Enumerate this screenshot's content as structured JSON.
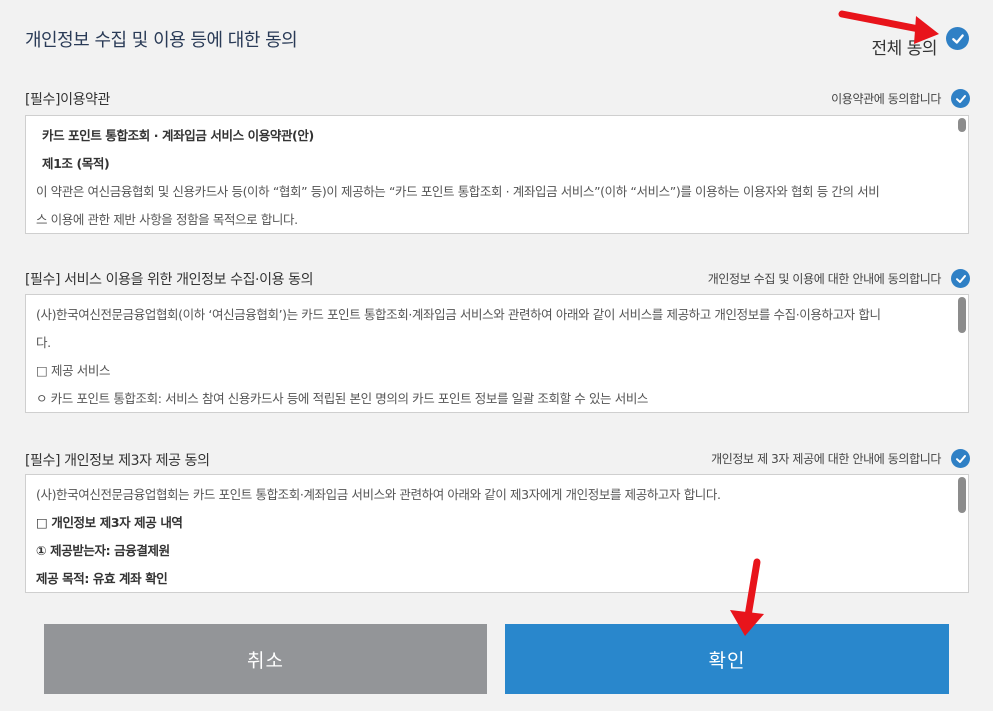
{
  "header": {
    "title": "개인정보 수집 및 이용 등에 대한 동의",
    "all_agree_label": "전체 동의"
  },
  "sections": [
    {
      "title": "[필수]이용약관",
      "agree_label": "이용약관에 동의합니다",
      "lines": [
        "카드 포인트 통합조회 · 계좌입금 서비스 이용약관(안)",
        "제1조 (목적)",
        "이 약관은 여신금융협회 및 신용카드사 등(이하 “협회” 등)이 제공하는 “카드 포인트 통합조회 · 계좌입금 서비스”(이하 “서비스”)를 이용하는 이용자와 협회 등 간의 서비",
        "스 이용에 관한 제반 사항을 정함을 목적으로 합니다."
      ]
    },
    {
      "title": "[필수] 서비스 이용을 위한 개인정보 수집·이용 동의",
      "agree_label": "개인정보 수집 및 이용에 대한 안내에 동의합니다",
      "lines": [
        "(사)한국여신전문금융업협회(이하 ‘여신금융협회’)는 카드 포인트 통합조회·계좌입금 서비스와 관련하여 아래와 같이 서비스를 제공하고 개인정보를 수집·이용하고자 합니",
        "다.",
        "□ 제공 서비스",
        "ㅇ 카드 포인트 통합조회: 서비스 참여 신용카드사 등에 적립된 본인 명의의 카드 포인트 정보를 일괄 조회할 수 있는 서비스"
      ]
    },
    {
      "title": "[필수] 개인정보 제3자 제공 동의",
      "agree_label": "개인정보 제 3자 제공에 대한 안내에 동의합니다",
      "lines": [
        "(사)한국여신전문금융업협회는 카드 포인트 통합조회·계좌입금 서비스와 관련하여 아래와 같이 제3자에게 개인정보를 제공하고자 합니다.",
        "□ 개인정보 제3자 제공 내역",
        "① 제공받는자: 금융결제원",
        "제공 목적: 유효 계좌 확인"
      ]
    }
  ],
  "buttons": {
    "cancel_label": "취소",
    "ok_label": "확인"
  },
  "colors": {
    "accent": "#2f80c5",
    "ok_button": "#2987cc",
    "cancel_button": "#939598",
    "annotation_arrow": "#e8141b"
  }
}
